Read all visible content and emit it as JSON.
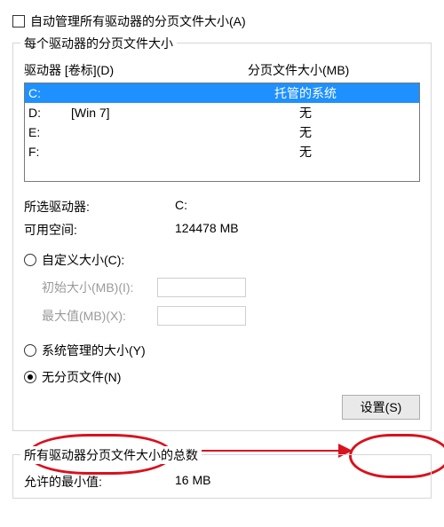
{
  "auto_manage_label": "自动管理所有驱动器的分页文件大小(A)",
  "group_title": "每个驱动器的分页文件大小",
  "headers": {
    "drive": "驱动器 [卷标](D)",
    "size": "分页文件大小(MB)"
  },
  "drives": [
    {
      "letter": "C:",
      "label": "",
      "size": "托管的系统",
      "selected": true
    },
    {
      "letter": "D:",
      "label": "[Win 7]",
      "size": "无",
      "selected": false
    },
    {
      "letter": "E:",
      "label": "",
      "size": "无",
      "selected": false
    },
    {
      "letter": "F:",
      "label": "",
      "size": "无",
      "selected": false
    }
  ],
  "selected_drive_label": "所选驱动器:",
  "selected_drive_value": "C:",
  "free_space_label": "可用空间:",
  "free_space_value": "124478 MB",
  "radio_custom": "自定义大小(C):",
  "initial_label": "初始大小(MB)(I):",
  "max_label": "最大值(MB)(X):",
  "radio_system": "系统管理的大小(Y)",
  "radio_none": "无分页文件(N)",
  "set_button": "设置(S)",
  "totals_title": "所有驱动器分页文件大小的总数",
  "min_allowed_label": "允许的最小值:",
  "min_allowed_value": "16 MB"
}
